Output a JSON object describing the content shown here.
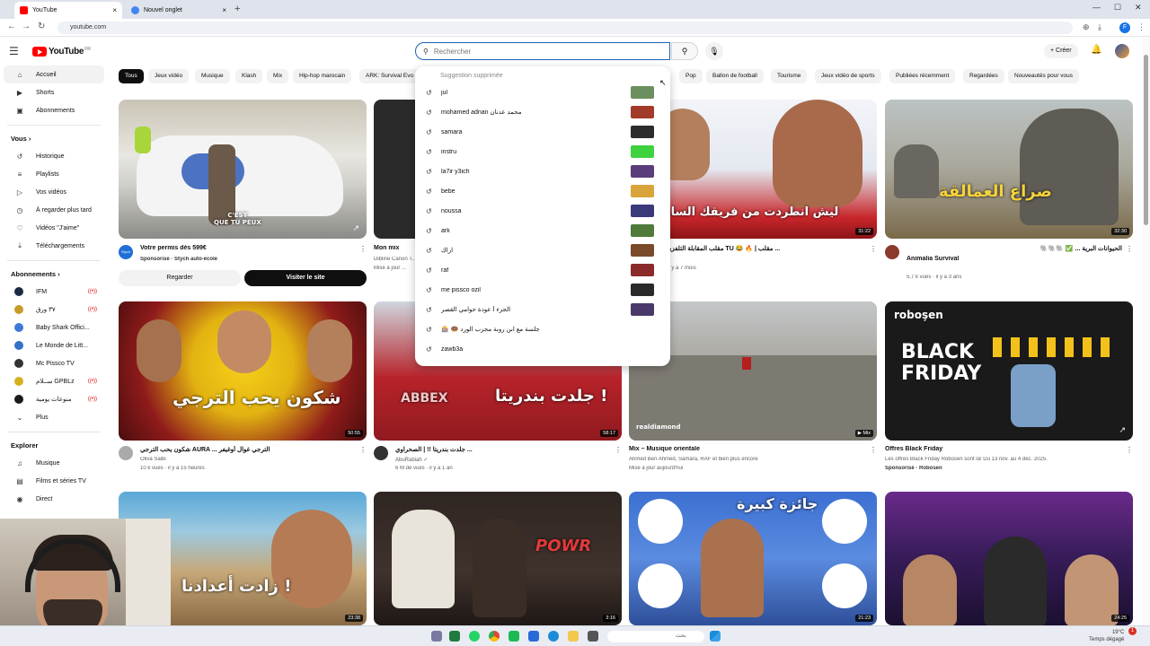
{
  "browser": {
    "tabs": [
      {
        "label": "YouTube",
        "close": "×"
      },
      {
        "label": "Nouvel onglet",
        "close": "×"
      }
    ],
    "new_tab": "+",
    "url": "youtube.com",
    "window_controls": [
      "—",
      "☐",
      "✕"
    ],
    "profile_initial": "F"
  },
  "header": {
    "logo_text": "YouTube",
    "logo_region": "FR",
    "search_placeholder": "Rechercher",
    "create_label": "+ Créer"
  },
  "sidebar": {
    "main": [
      {
        "label": "Accueil",
        "icon": "home-icon",
        "glyph": "⌂"
      },
      {
        "label": "Shorts",
        "icon": "shorts-icon",
        "glyph": "▶"
      },
      {
        "label": "Abonnements",
        "icon": "subscriptions-icon",
        "glyph": "▣"
      }
    ],
    "you_header": "Vous  ›",
    "you": [
      {
        "label": "Historique",
        "glyph": "↺"
      },
      {
        "label": "Playlists",
        "glyph": "≡"
      },
      {
        "label": "Vos vidéos",
        "glyph": "▷"
      },
      {
        "label": "À regarder plus tard",
        "glyph": "◷"
      },
      {
        "label": "Vidéos \"J'aime\"",
        "glyph": "♡"
      },
      {
        "label": "Téléchargements",
        "glyph": "⤓"
      }
    ],
    "subs_header": "Abonnements  ›",
    "subs": [
      {
        "label": "IFM",
        "color": "#1c2a44"
      },
      {
        "label": "٣٧ ورق",
        "color": "#c89a2a"
      },
      {
        "label": "Baby Shark Offici...",
        "color": "#3d7ad6"
      },
      {
        "label": "Le Monde de Litt...",
        "color": "#3570c8"
      },
      {
        "label": "Mc Pissco TV",
        "color": "#333333"
      },
      {
        "label": "ســلام GPBLz",
        "color": "#d4b020"
      },
      {
        "label": "منوعات يومية",
        "color": "#1b1b1b"
      }
    ],
    "more_label": "Plus",
    "explore_header": "Explorer",
    "explore": [
      {
        "label": "Musique",
        "glyph": "♫"
      },
      {
        "label": "Films et séries TV",
        "glyph": "▤"
      },
      {
        "label": "Direct",
        "glyph": "◉"
      }
    ]
  },
  "chips": [
    "Tous",
    "Jeux vidéo",
    "Musique",
    "Klash",
    "Mix",
    "Hip-hop marocain",
    "ARK: Survival Evo",
    "Pop",
    "Ballon de football",
    "Tourisme",
    "Jeux vidéo de sports",
    "Publiées récemment",
    "Regardées",
    "Nouveautés pour vous"
  ],
  "dropdown": {
    "header": "Suggestion supprimée",
    "items": [
      {
        "text": "jul",
        "thumb": "#6b8f5e"
      },
      {
        "text": "mohamed adnan محمد عدنان",
        "thumb": "#a23b2a"
      },
      {
        "text": "samara",
        "thumb": "#2c2c2c"
      },
      {
        "text": "instru",
        "thumb": "#3ed23e"
      },
      {
        "text": "la7ir y3ich",
        "thumb": "#5a3d7a"
      },
      {
        "text": "bebe",
        "thumb": "#d9a43a"
      },
      {
        "text": "noussa",
        "thumb": "#3a3a7a"
      },
      {
        "text": "ark",
        "thumb": "#4f7a3a"
      },
      {
        "text": "اراك",
        "thumb": "#7a4a2a"
      },
      {
        "text": "raf",
        "thumb": "#8a2a2a"
      },
      {
        "text": "me pissco ozil",
        "thumb": "#2a2a2a"
      },
      {
        "text": "الجزء أ عودة حوامي القصر",
        "thumb": "#4a3a6a"
      },
      {
        "text": "🎰 🍩 جلسة مع ابن روبة مجرب الورد",
        "thumb": ""
      },
      {
        "text": "zawb3a",
        "thumb": ""
      }
    ]
  },
  "videos": [
    {
      "title": "Votre permis dès 599€",
      "meta1": "Sponsorisé · Stych auto-école",
      "meta2": "",
      "duration": "",
      "overlay": "C'EST\nQUE TU PEUX",
      "avatar": "#1f6fd6"
    },
    {
      "title": "Mon mix",
      "meta1": "Dibline Canon T...",
      "meta2": "Mise à jour ...",
      "duration": "",
      "overlay": "",
      "avatar": ""
    },
    {
      "title": "مقلب المقابلة التلفزيونية في أعصاب TU 😂 🔥 | مقلب ...",
      "meta1": "اوتور TV",
      "meta2": "3,1 M de vues · il y a 7 mois",
      "duration": "31:22",
      "overlay": "ليش انطردت من فريقك السابق",
      "avatar": ""
    },
    {
      "title": "الحيوانات البرية ... ✅ 🐘🐘🐘",
      "meta1": "Animalia Survival",
      "meta2": "5,7 k vues · il y a 3 ans",
      "duration": "32:30",
      "overlay": "صراع العمالقة",
      "avatar": "#8a3a2a"
    },
    {
      "title": "شكون يحب الترجي AURA ... الترجي غوال أوغيفر",
      "meta1": "Oliva Saibi",
      "meta2": "10 k vues · il y a 15 heures",
      "duration": "50:55",
      "overlay": "شكون يحب الترجي",
      "avatar": "#aaaaaa"
    },
    {
      "title": "جلدت بندريتا !! | الصحراوي ...",
      "meta1": "AbuRabiah ✓",
      "meta2": "6 M de vues · il y a 1 an",
      "duration": "58:17",
      "overlay": "جلدت بندريتا !",
      "avatar": "#333333"
    },
    {
      "title": "Mix – Musique orientale",
      "meta1": "Ahmed Ben Ahmed, Samara, RAF et bien plus encore",
      "meta2": "Mise à jour aujourd'hui",
      "duration": "▶ Mix",
      "overlay": "",
      "avatar": ""
    },
    {
      "title": "Offres Black Friday",
      "meta1": "Les offres Black Friday Robosen sont là! Du 13 nov. au 4 déc. 2025.",
      "meta2": "Sponsorisé · Robosen",
      "duration": "",
      "overlay": "BLACK\nFRIDAY",
      "avatar": ""
    },
    {
      "title": "",
      "meta1": "",
      "meta2": "",
      "duration": "23:38",
      "overlay": "زادت أعدادنا !",
      "avatar": ""
    },
    {
      "title": "",
      "meta1": "",
      "meta2": "",
      "duration": "3:16",
      "overlay": "POWR",
      "avatar": ""
    },
    {
      "title": "",
      "meta1": "",
      "meta2": "",
      "duration": "21:23",
      "overlay": "جائزة كبيرة",
      "avatar": ""
    },
    {
      "title": "",
      "meta1": "",
      "meta2": "",
      "duration": "24:25",
      "overlay": "",
      "avatar": ""
    }
  ],
  "ad_buttons": {
    "secondary": "Regarder",
    "primary": "Visiter le site"
  },
  "brand": {
    "robosen": "roboşen",
    "realdiamond": "realdiamond",
    "stych": "Stych"
  },
  "taskbar": {
    "search_text": "بحث",
    "time": "19°C",
    "date": "Temps dégagé",
    "badge": "1"
  }
}
